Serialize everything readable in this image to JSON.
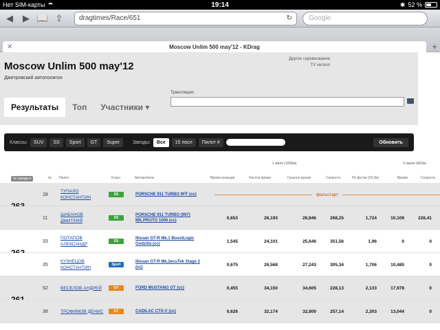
{
  "statusbar": {
    "carrier": "Нет SIM-карты",
    "time": "19:14",
    "battery": "52 %"
  },
  "browser": {
    "url": "dragtimes/Race/651",
    "search_placeholder": "Google",
    "tab_title": "Moscow Unlim 500 may'12 - KDrag"
  },
  "header": {
    "title": "Moscow Unlim 500 may'12",
    "venue": "Дмитровский автополигон",
    "other_competition": "Другое соревнование",
    "tv_version": "TV version"
  },
  "tabs": [
    {
      "label": "Результаты"
    },
    {
      "label": "Топ"
    },
    {
      "label": "Участники ▾"
    }
  ],
  "stream": {
    "label": "Трансляция:"
  },
  "filter": {
    "classes_label": "Классы:",
    "classes": [
      "SUV",
      "SS",
      "Sport",
      "GT",
      "Super"
    ],
    "stars_label": "Заезды:",
    "stars": [
      "Все",
      "15 посл"
    ],
    "pilot_label": "Пилот #",
    "refresh": "Обновить"
  },
  "units": {
    "mile": "¼ мили (402м)",
    "mile_alt": "1 миля (1609м)"
  },
  "columns": {
    "sort": "№ заезда ▾",
    "num": "№",
    "pilot": "Пилот",
    "class": "Класс",
    "car": "Автомобиль",
    "reaction": "Время реакции",
    "net": "Чистое время",
    "gross": "Грязное время",
    "speed": "Скорость",
    "sixty": "60 футов (18.3м)",
    "time": "Время",
    "speed2": "Скорость"
  },
  "colors": {
    "SS": "#3aa33a",
    "Sport": "#1e6fc0",
    "GT": "#e08a1e",
    "falsestart": "#c0500a"
  },
  "rows": [
    {
      "group": "263",
      "num": "28",
      "pilot": "ТУПАЛО КОНСТАНТИН",
      "class": "SS",
      "car": "PORSCHE 911 TURBO 9FF (cc)",
      "falsestart": "фальстарт"
    },
    {
      "group": "",
      "num": "11",
      "pilot": "ШАБАНОВ ДМИТРИЙ",
      "class": "SS",
      "car": "PORSCHE 911 TURBO (997) MK.PROTO 1000 (cc)",
      "reaction": "0,653",
      "net": "26,193",
      "gross": "26,846",
      "speed": "268,25",
      "sixty": "1,724",
      "time": "10,109",
      "speed2": "226,41"
    },
    {
      "group": "262",
      "num": "33",
      "pilot": "ПОТАПОВ АЛЕКСАНДР",
      "class": "SS",
      "car": "Nissan GT-R Mk.1 BoostLogic Godzilla (cc)",
      "reaction": "1,545",
      "net": "24,101",
      "gross": "25,646",
      "speed": "351,56",
      "sixty": "1,96",
      "time": "0",
      "speed2": "0"
    },
    {
      "group": "",
      "num": "35",
      "pilot": "КУЗНЕЦОВ КОНСТАНТИН",
      "class": "Sport",
      "car": "Nissan GT-R Mk.2ecuTek Stage 2 (cc)",
      "reaction": "0,675",
      "net": "26,568",
      "gross": "27,243",
      "speed": "305,34",
      "sixty": "1,706",
      "time": "10,485",
      "speed2": "0"
    },
    {
      "group": "261",
      "num": "52",
      "pilot": "ВЕСЕЛОВ АНДРЕЙ",
      "class": "GT",
      "car": "FORD MUSTANG GT (cc)",
      "reaction": "0,455",
      "net": "34,150",
      "gross": "34,605",
      "speed": "228,13",
      "sixty": "2,133",
      "time": "17,978",
      "speed2": "0"
    },
    {
      "group": "",
      "num": "38",
      "pilot": "ТРОФИМОВ ДЕНИС",
      "class": "GT",
      "car": "CADILAC CTS-V (cc)",
      "reaction": "0,626",
      "net": "32,174",
      "gross": "32,800",
      "speed": "257,14",
      "sixty": "2,303",
      "time": "13,044",
      "speed2": "0"
    }
  ]
}
